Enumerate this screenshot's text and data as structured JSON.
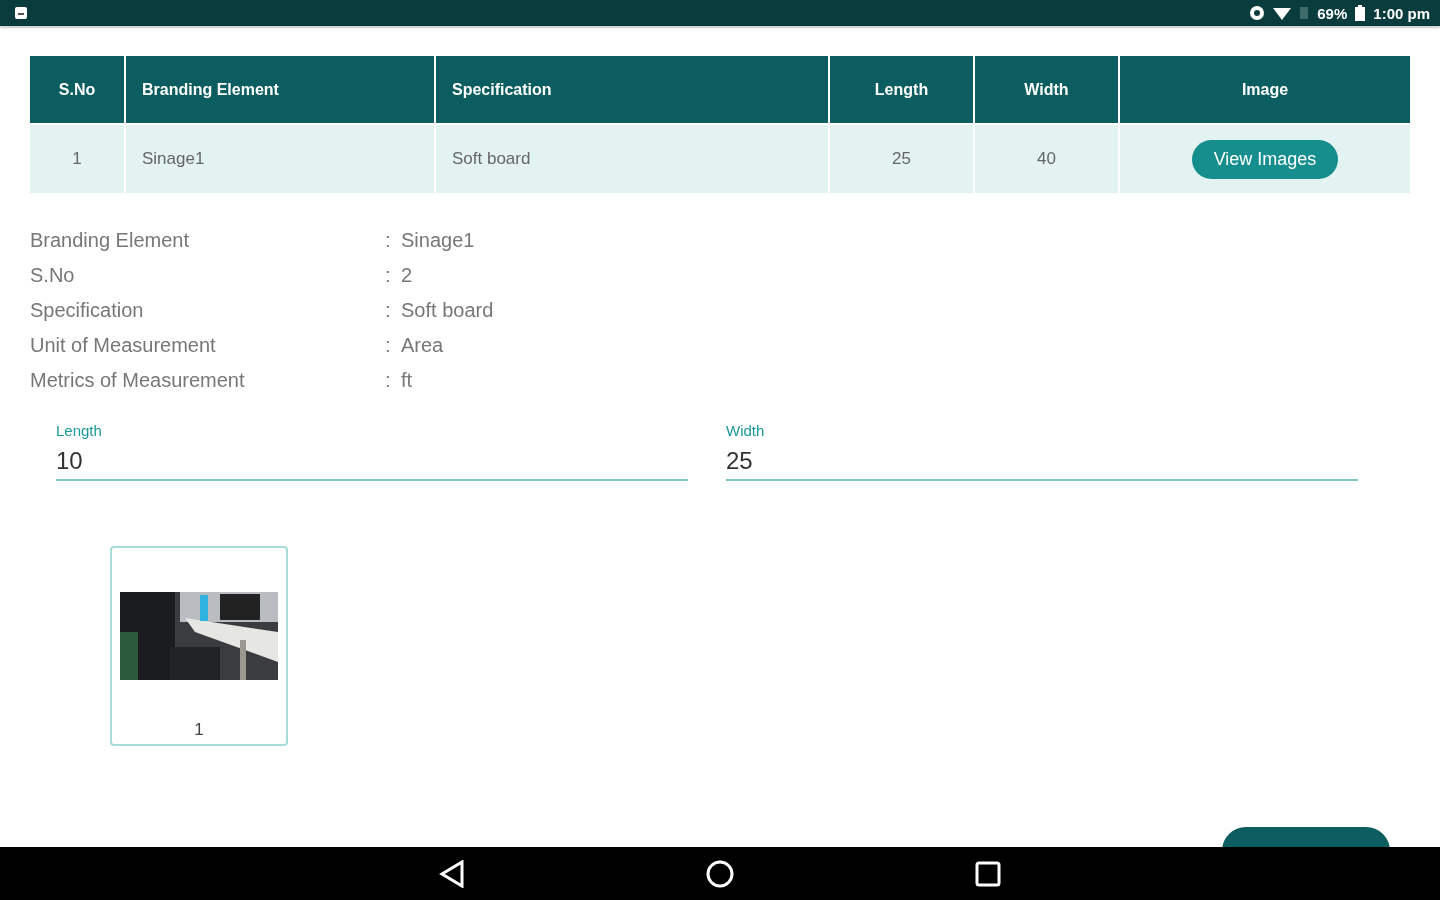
{
  "status_bar": {
    "battery": "69%",
    "time": "1:00 pm"
  },
  "table": {
    "columns": [
      "S.No",
      "Branding Element",
      "Specification",
      "Length",
      "Width",
      "Image"
    ],
    "rows": [
      {
        "cells": [
          "1",
          "Sinage1",
          "Soft board",
          "25",
          "40"
        ],
        "button": "View Images"
      }
    ]
  },
  "details": [
    {
      "label": "Branding Element",
      "separator": ":",
      "value": "Sinage1"
    },
    {
      "label": "S.No",
      "separator": ":",
      "value": "2"
    },
    {
      "label": "Specification",
      "separator": ":",
      "value": "Soft board"
    },
    {
      "label": "Unit of Measurement",
      "separator": ":",
      "value": "Area"
    },
    {
      "label": "Metrics of Measurement",
      "separator": ":",
      "value": "ft"
    }
  ],
  "fields": [
    {
      "label": "Length",
      "value": "10"
    },
    {
      "label": "Width",
      "value": "25"
    }
  ],
  "images": [
    {
      "kind": "picture",
      "caption": "1"
    }
  ]
}
